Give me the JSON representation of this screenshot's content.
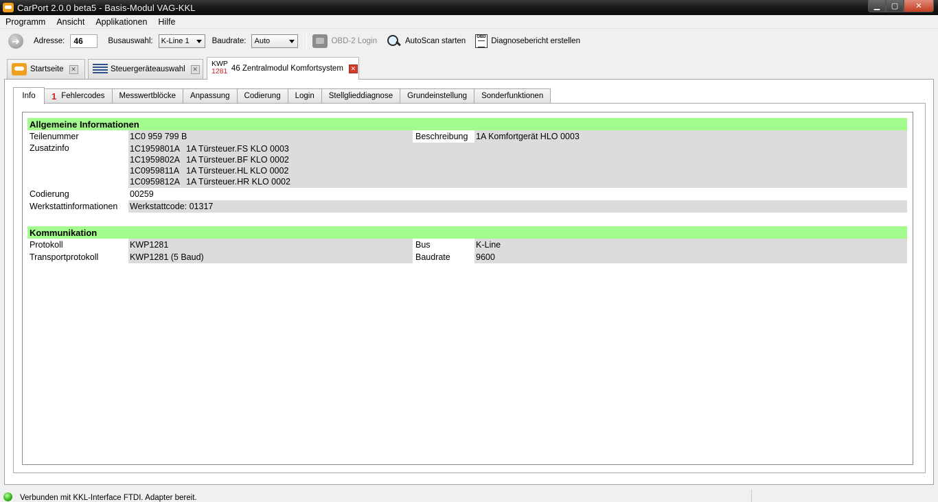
{
  "window": {
    "title": "CarPort 2.0.0 beta5 - Basis-Modul VAG-KKL",
    "minimize": "▁",
    "maximize": "▢",
    "close": "✕"
  },
  "menu": [
    "Programm",
    "Ansicht",
    "Applikationen",
    "Hilfe"
  ],
  "toolbar": {
    "address_label": "Adresse:",
    "address_value": "46",
    "bus_label": "Busauswahl:",
    "bus_value": "K-Line 1",
    "baud_label": "Baudrate:",
    "baud_value": "Auto",
    "obd_login": "OBD-2 Login",
    "autoscan": "AutoScan starten",
    "report": "Diagnosebericht erstellen"
  },
  "doc_tabs": {
    "start": "Startseite",
    "ecu_select": "Steuergeräteauswahl",
    "kwp_top": "KWP",
    "kwp_num": "1281",
    "module": "46 Zentralmodul Komfortsystem"
  },
  "sub_tabs": {
    "info": "Info",
    "fault_count": "1",
    "faults": "Fehlercodes",
    "measure": "Messwertblöcke",
    "adapt": "Anpassung",
    "coding": "Codierung",
    "login": "Login",
    "actuator": "Stellglieddiagnose",
    "basic": "Grundeinstellung",
    "special": "Sonderfunktionen"
  },
  "general": {
    "header": "Allgemeine Informationen",
    "part_label": "Teilenummer",
    "part_value": "1C0 959 799 B",
    "desc_label": "Beschreibung",
    "desc_value": "1A Komfortgerät HLO 0003",
    "extra_label": "Zusatzinfo",
    "extra": [
      {
        "code": "1C1959801A",
        "text": "1A Türsteuer.FS KLO 0003"
      },
      {
        "code": "1C1959802A",
        "text": "1A Türsteuer.BF KLO 0002"
      },
      {
        "code": "1C0959811A",
        "text": "1A Türsteuer.HL KLO 0002"
      },
      {
        "code": "1C0959812A",
        "text": "1A Türsteuer.HR KLO 0002"
      }
    ],
    "coding_label": "Codierung",
    "coding_value": "00259",
    "workshop_label": "Werkstattinformationen",
    "workshop_value": "Werkstattcode: 01317"
  },
  "comm": {
    "header": "Kommunikation",
    "protocol_label": "Protokoll",
    "protocol_value": "KWP1281",
    "bus_label": "Bus",
    "bus_value": "K-Line",
    "transport_label": "Transportprotokoll",
    "transport_value": "KWP1281 (5 Baud)",
    "baud_label": "Baudrate",
    "baud_value": "9600"
  },
  "status": {
    "message": "Verbunden mit KKL-Interface FTDI. Adapter bereit."
  }
}
